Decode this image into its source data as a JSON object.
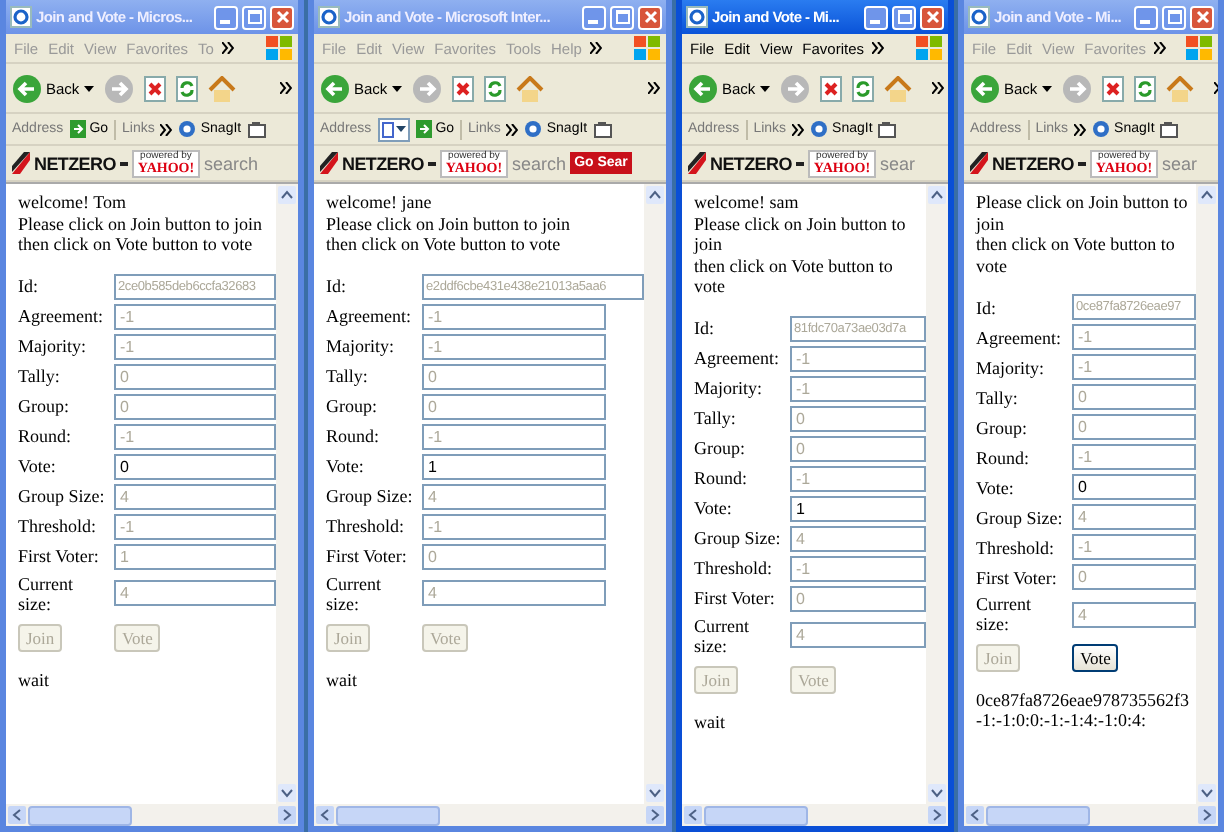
{
  "windows": [
    {
      "title": "Join and Vote - Micros...",
      "active": false,
      "menu": [
        "File",
        "Edit",
        "View",
        "Favorites",
        "To"
      ],
      "back": "Back",
      "address": {
        "label": "Address",
        "go": "Go"
      },
      "links": "Links",
      "snagit": "SnagIt",
      "netzero": "NETZERO",
      "powered_by": "powered by",
      "yahoo": "YAHOO!",
      "search": "search",
      "lines": [
        "welcome! Tom",
        "Please click on Join button to join",
        "then click on Vote button to vote"
      ],
      "fields": [
        {
          "label": "Id:",
          "value": "2ce0b585deb6ccfa32683",
          "disabled": true
        },
        {
          "label": "Agreement:",
          "value": "-1",
          "disabled": true
        },
        {
          "label": "Majority:",
          "value": "-1",
          "disabled": true
        },
        {
          "label": "Tally:",
          "value": "0",
          "disabled": true
        },
        {
          "label": "Group:",
          "value": "0",
          "disabled": true
        },
        {
          "label": "Round:",
          "value": "-1",
          "disabled": true
        },
        {
          "label": "Vote:",
          "value": "0",
          "disabled": false
        },
        {
          "label": "Group Size:",
          "value": "4",
          "disabled": true
        },
        {
          "label": "Threshold:",
          "value": "-1",
          "disabled": true
        },
        {
          "label": "First Voter:",
          "value": "1",
          "disabled": true
        },
        {
          "label": "Current size:",
          "value": "4",
          "disabled": true
        }
      ],
      "buttons": [
        {
          "label": "Join",
          "disabled": true
        },
        {
          "label": "Vote",
          "disabled": true
        }
      ],
      "status": [
        "wait"
      ]
    },
    {
      "title": "Join and Vote - Microsoft Inter...",
      "active": false,
      "menu": [
        "File",
        "Edit",
        "View",
        "Favorites",
        "Tools",
        "Help"
      ],
      "back": "Back",
      "address": {
        "label": "Address",
        "go": "Go",
        "dropdown": true
      },
      "links": "Links",
      "snagit": "SnagIt",
      "netzero": "NETZERO",
      "powered_by": "powered by",
      "yahoo": "YAHOO!",
      "search": "search",
      "go_search": "Go Sear",
      "lines": [
        "welcome! jane",
        "Please click on Join button to join",
        "then click on Vote button to vote"
      ],
      "fields": [
        {
          "label": "Id:",
          "value": "e2ddf6cbe431e438e21013a5aa6",
          "disabled": true
        },
        {
          "label": "Agreement:",
          "value": "-1",
          "disabled": true
        },
        {
          "label": "Majority:",
          "value": "-1",
          "disabled": true
        },
        {
          "label": "Tally:",
          "value": "0",
          "disabled": true
        },
        {
          "label": "Group:",
          "value": "0",
          "disabled": true
        },
        {
          "label": "Round:",
          "value": "-1",
          "disabled": true
        },
        {
          "label": "Vote:",
          "value": "1",
          "disabled": false
        },
        {
          "label": "Group Size:",
          "value": "4",
          "disabled": true
        },
        {
          "label": "Threshold:",
          "value": "-1",
          "disabled": true
        },
        {
          "label": "First Voter:",
          "value": "0",
          "disabled": true
        },
        {
          "label": "Current size:",
          "value": "4",
          "disabled": true
        }
      ],
      "buttons": [
        {
          "label": "Join",
          "disabled": true
        },
        {
          "label": "Vote",
          "disabled": true
        }
      ],
      "status": [
        "wait"
      ]
    },
    {
      "title": "Join and Vote - Mi...",
      "active": true,
      "menu": [
        "File",
        "Edit",
        "View",
        "Favorites"
      ],
      "back": "Back",
      "address": {
        "label": "Address"
      },
      "links": "Links",
      "snagit": "SnagIt",
      "netzero": "NETZERO",
      "powered_by": "powered by",
      "yahoo": "YAHOO!",
      "search": "sear",
      "lines": [
        "welcome! sam",
        "Please click on Join button to join",
        "then click on Vote button to vote"
      ],
      "fields": [
        {
          "label": "Id:",
          "value": "81fdc70a73ae03d7a",
          "disabled": true
        },
        {
          "label": "Agreement:",
          "value": "-1",
          "disabled": true
        },
        {
          "label": "Majority:",
          "value": "-1",
          "disabled": true
        },
        {
          "label": "Tally:",
          "value": "0",
          "disabled": true
        },
        {
          "label": "Group:",
          "value": "0",
          "disabled": true
        },
        {
          "label": "Round:",
          "value": "-1",
          "disabled": true
        },
        {
          "label": "Vote:",
          "value": "1",
          "disabled": false
        },
        {
          "label": "Group Size:",
          "value": "4",
          "disabled": true
        },
        {
          "label": "Threshold:",
          "value": "-1",
          "disabled": true
        },
        {
          "label": "First Voter:",
          "value": "0",
          "disabled": true
        },
        {
          "label": "Current size:",
          "value": "4",
          "disabled": true
        }
      ],
      "buttons": [
        {
          "label": "Join",
          "disabled": true
        },
        {
          "label": "Vote",
          "disabled": true
        }
      ],
      "status": [
        "wait"
      ]
    },
    {
      "title": "Join and Vote - Mi...",
      "active": false,
      "menu": [
        "File",
        "Edit",
        "View",
        "Favorites"
      ],
      "back": "Back",
      "address": {
        "label": "Address"
      },
      "links": "Links",
      "snagit": "SnagIt",
      "netzero": "NETZERO",
      "powered_by": "powered by",
      "yahoo": "YAHOO!",
      "search": "sear",
      "lines": [
        "Please click on Join button to join",
        "then click on Vote button to vote"
      ],
      "fields": [
        {
          "label": "Id:",
          "value": "0ce87fa8726eae97",
          "disabled": true
        },
        {
          "label": "Agreement:",
          "value": "-1",
          "disabled": true
        },
        {
          "label": "Majority:",
          "value": "-1",
          "disabled": true
        },
        {
          "label": "Tally:",
          "value": "0",
          "disabled": true
        },
        {
          "label": "Group:",
          "value": "0",
          "disabled": true
        },
        {
          "label": "Round:",
          "value": "-1",
          "disabled": true
        },
        {
          "label": "Vote:",
          "value": "0",
          "disabled": false
        },
        {
          "label": "Group Size:",
          "value": "4",
          "disabled": true
        },
        {
          "label": "Threshold:",
          "value": "-1",
          "disabled": true
        },
        {
          "label": "First Voter:",
          "value": "0",
          "disabled": true
        },
        {
          "label": "Current size:",
          "value": "4",
          "disabled": true
        }
      ],
      "buttons": [
        {
          "label": "Join",
          "disabled": true
        },
        {
          "label": "Vote",
          "disabled": false
        }
      ],
      "status": [
        "0ce87fa8726eae978735562f3",
        "-1:-1:0:0:-1:-1:4:-1:0:4:"
      ]
    }
  ]
}
